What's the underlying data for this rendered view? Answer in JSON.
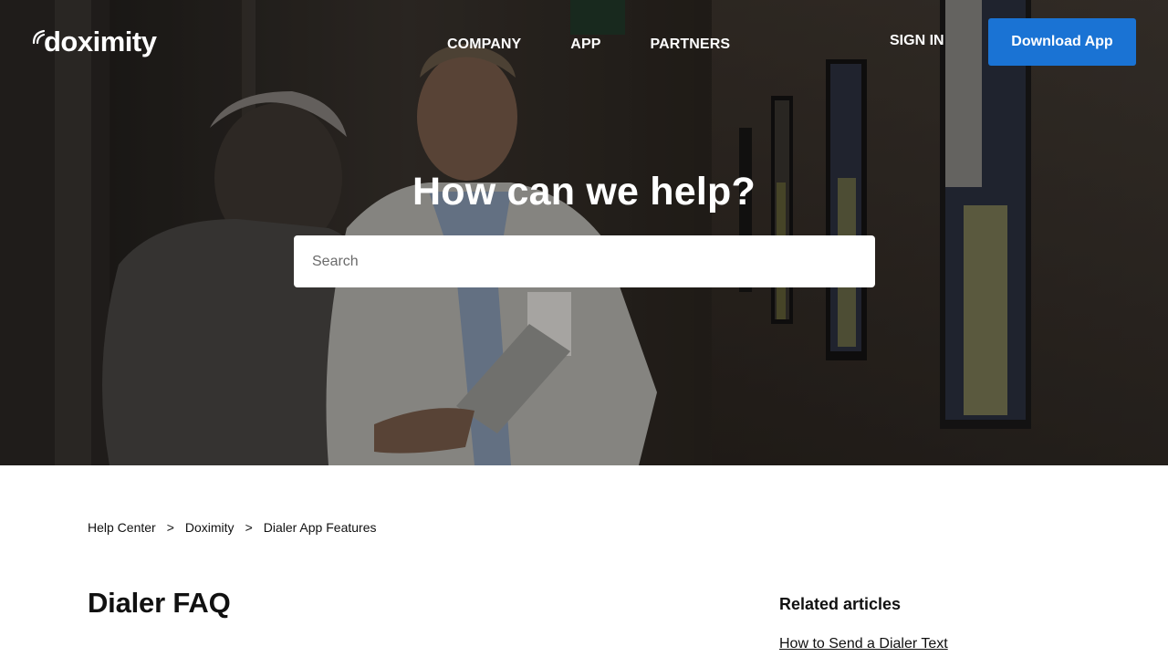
{
  "header": {
    "logo_text": "doximity",
    "nav": [
      {
        "label": "COMPANY"
      },
      {
        "label": "APP"
      },
      {
        "label": "PARTNERS"
      }
    ],
    "sign_in_label": "SIGN IN",
    "download_label": "Download App"
  },
  "hero": {
    "title": "How can we help?",
    "search_placeholder": "Search"
  },
  "breadcrumb": {
    "items": [
      {
        "label": "Help Center"
      },
      {
        "label": "Doximity"
      },
      {
        "label": "Dialer App Features"
      }
    ],
    "separator": ">"
  },
  "article": {
    "title": "Dialer FAQ"
  },
  "related": {
    "heading": "Related articles",
    "links": [
      {
        "label": "How to Send a Dialer Text"
      }
    ]
  },
  "colors": {
    "accent": "#1a73d4",
    "hero_overlay": "#2a2420",
    "text": "#111111"
  }
}
